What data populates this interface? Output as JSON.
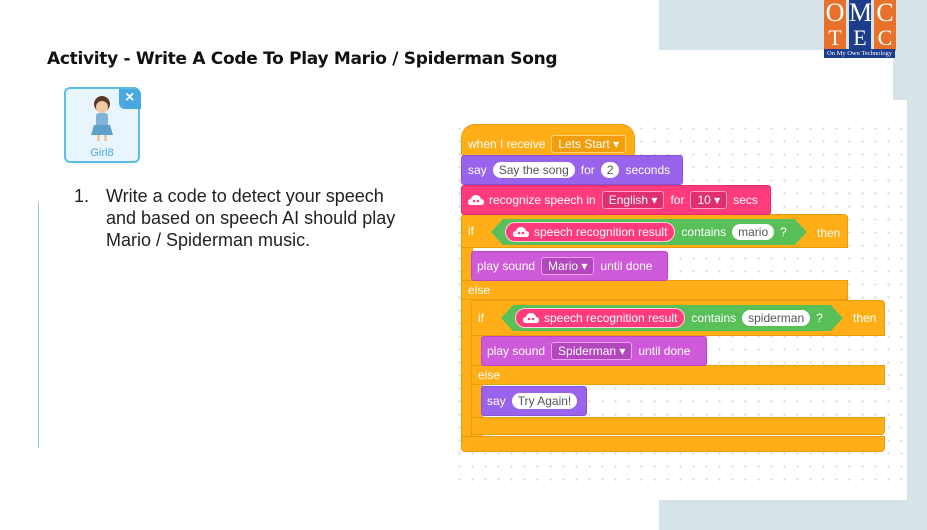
{
  "header": {
    "title": "Activity  - Write A Code To Play Mario / Spiderman Song"
  },
  "logo": {
    "letters_top": [
      "O",
      "M",
      "C"
    ],
    "letters_bottom": [
      "T",
      "E",
      "C"
    ],
    "tagline": "On My Own Technology",
    "colors": {
      "orange": "#e8722c",
      "blue": "#1c3d8c"
    }
  },
  "sprite": {
    "name": "Girl8",
    "close_icon": "close-icon"
  },
  "instructions": [
    {
      "number": "1.",
      "text": "Write a code to detect your speech and based on speech AI should play Mario / Spiderman music."
    }
  ],
  "code": {
    "hat": {
      "label": "when I receive",
      "message": "Lets Start"
    },
    "say1": {
      "label": "say",
      "text": "Say the song",
      "for_label": "for",
      "seconds": "2",
      "unit": "seconds"
    },
    "recognize": {
      "label": "recognize speech in",
      "language": "English",
      "for_label": "for",
      "duration": "10",
      "unit": "secs"
    },
    "if1": {
      "if_label": "if",
      "reporter": "speech recognition result",
      "contains_label": "contains",
      "value": "mario",
      "question": "?",
      "then_label": "then"
    },
    "play1": {
      "label": "play sound",
      "sound": "Mario",
      "until": "until done"
    },
    "else1": {
      "label": "else"
    },
    "if2": {
      "if_label": "if",
      "reporter": "speech recognition result",
      "contains_label": "contains",
      "value": "spiderman",
      "question": "?",
      "then_label": "then"
    },
    "play2": {
      "label": "play sound",
      "sound": "Spiderman",
      "until": "until done"
    },
    "else2": {
      "label": "else"
    },
    "say2": {
      "label": "say",
      "text": "Try Again!"
    }
  },
  "colors": {
    "events": "#ffae17",
    "looks": "#9a63ec",
    "ai": "#ff3b7b",
    "sound": "#cf5ad9",
    "operators": "#59c059"
  }
}
